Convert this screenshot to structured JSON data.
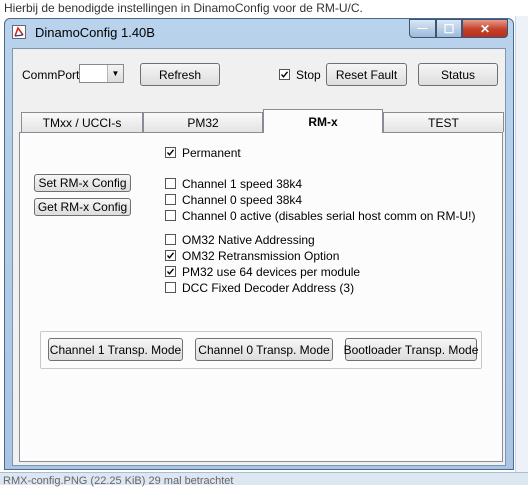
{
  "page": {
    "caption": "Hierbij de benodigde instellingen in DinamoConfig voor de RM-U/C.",
    "footer": "RMX-config.PNG (22.25 KiB) 29 mal betrachtet"
  },
  "window": {
    "title": "DinamoConfig 1.40B",
    "icon": "app-icon",
    "controls": {
      "minimize": "—",
      "maximize": "☐",
      "close": "✕"
    }
  },
  "toolbar": {
    "commport_label": "CommPort",
    "commport_value": "",
    "refresh_label": "Refresh",
    "stop_label": "Stop",
    "stop_checked": true,
    "reset_fault_label": "Reset Fault",
    "status_label": "Status"
  },
  "tabs": [
    {
      "label": "TMxx / UCCI-s",
      "active": false
    },
    {
      "label": "PM32",
      "active": false
    },
    {
      "label": "RM-x",
      "active": true
    },
    {
      "label": "TEST",
      "active": false
    }
  ],
  "rmx": {
    "permanent": {
      "label": "Permanent",
      "checked": true
    },
    "set_config_label": "Set RM-x Config",
    "get_config_label": "Get RM-x Config",
    "options_group1": [
      {
        "label": "Channel 1 speed 38k4",
        "checked": false
      },
      {
        "label": "Channel 0 speed 38k4",
        "checked": false
      },
      {
        "label": "Channel 0 active (disables serial host comm on RM-U!)",
        "checked": false
      }
    ],
    "options_group2": [
      {
        "label": "OM32 Native Addressing",
        "checked": false
      },
      {
        "label": "OM32 Retransmission Option",
        "checked": true
      },
      {
        "label": "PM32 use 64 devices per module",
        "checked": true
      },
      {
        "label": "DCC Fixed Decoder Address (3)",
        "checked": false
      }
    ],
    "transp_buttons": [
      "Channel 1 Transp. Mode",
      "Channel 0 Transp. Mode",
      "Bootloader Transp. Mode"
    ]
  }
}
